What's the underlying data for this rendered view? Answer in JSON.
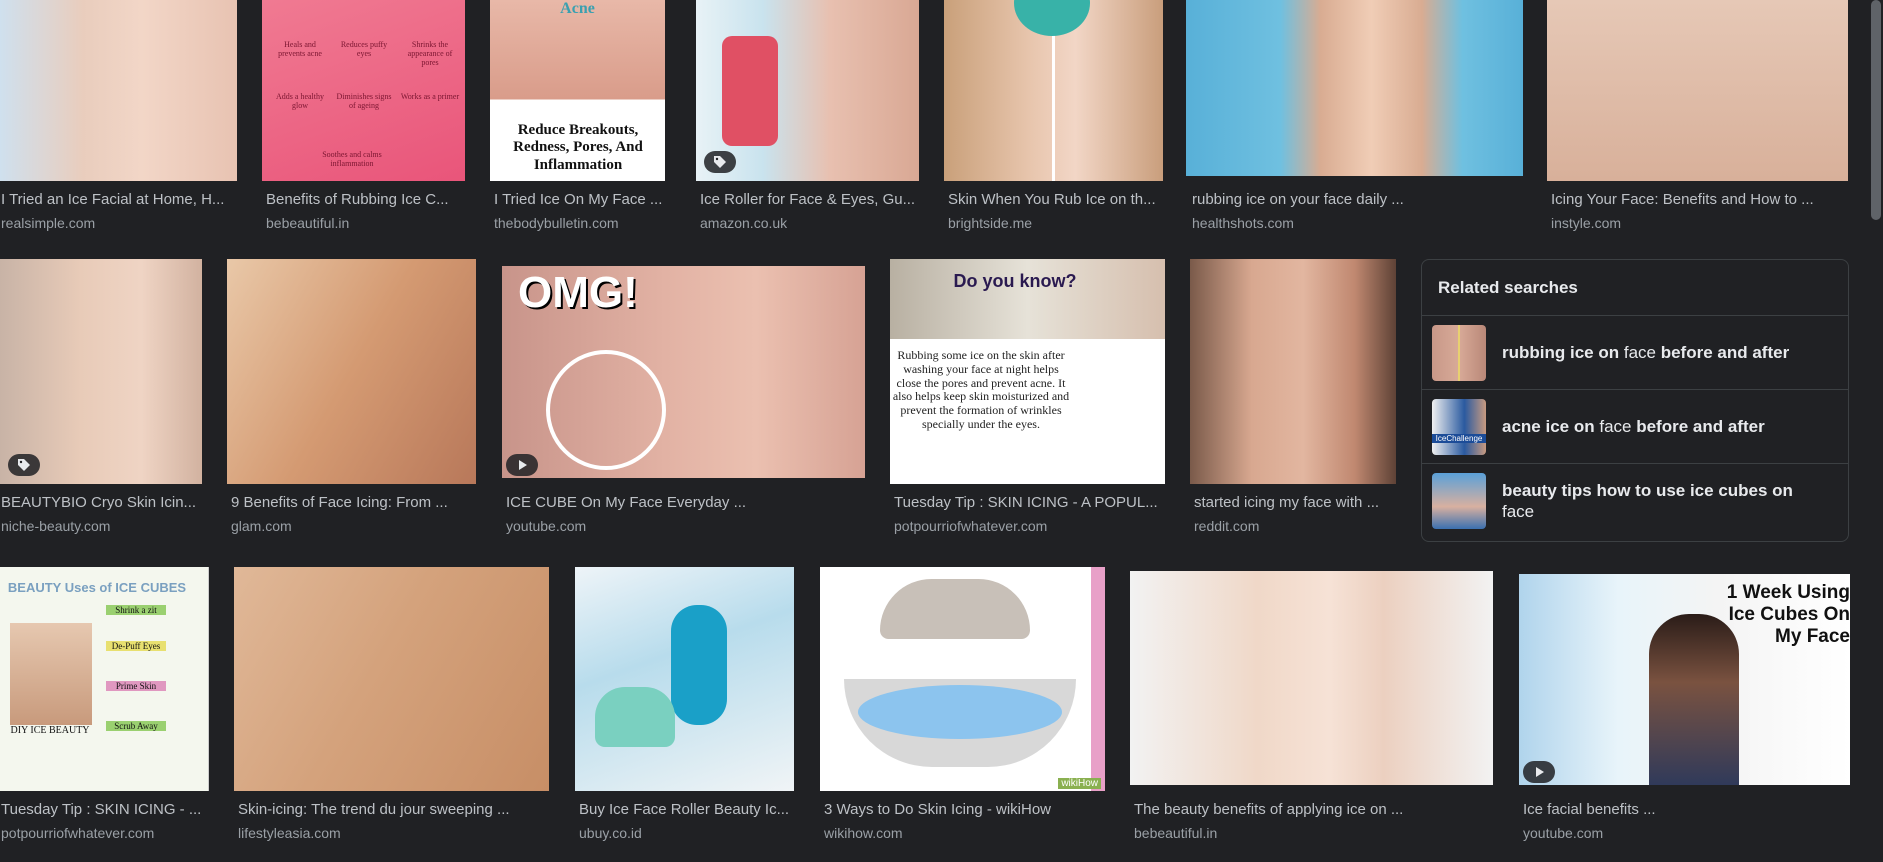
{
  "rows": [
    {
      "items": [
        {
          "title": "I Tried an Ice Facial at Home, H...",
          "source": "realsimple.com",
          "badge": ""
        },
        {
          "title": "Benefits of Rubbing Ice C...",
          "source": "bebeautiful.in",
          "badge": "",
          "overlay": [
            "Heals and prevents acne",
            "Reduces puffy eyes",
            "Shrinks the appearance of pores",
            "Adds a healthy glow",
            "Diminishes signs of ageing",
            "Works as a primer",
            "Soothes and calms inflammation"
          ]
        },
        {
          "title": "I Tried Ice On My Face ...",
          "source": "thebodybulletin.com",
          "badge": "",
          "overlay_top": "Acne",
          "overlay": "Reduce Breakouts, Redness, Pores, And Inflammation"
        },
        {
          "title": "Ice Roller for Face & Eyes, Gu...",
          "source": "amazon.co.uk",
          "badge": "tag"
        },
        {
          "title": "Skin When You Rub Ice on th...",
          "source": "brightside.me",
          "badge": ""
        },
        {
          "title": "rubbing ice on your face daily ...",
          "source": "healthshots.com",
          "badge": ""
        },
        {
          "title": "Icing Your Face: Benefits and How to ...",
          "source": "instyle.com",
          "badge": ""
        }
      ]
    },
    {
      "items": [
        {
          "title": "BEAUTYBIO Cryo Skin Icin...",
          "source": "niche-beauty.com",
          "badge": "tag"
        },
        {
          "title": "9 Benefits of Face Icing: From ...",
          "source": "glam.com",
          "badge": ""
        },
        {
          "title": "ICE CUBE On My Face Everyday ...",
          "source": "youtube.com",
          "badge": "play",
          "overlay": "OMG!"
        },
        {
          "title": "Tuesday Tip : SKIN ICING - A POPUL...",
          "source": "potpourriofwhatever.com",
          "badge": "",
          "overlay_top": "Do you know?",
          "overlay": "Rubbing some ice on the skin after washing your face at night helps close the pores and prevent acne. It also helps keep skin moisturized and prevent the formation of wrinkles specially under the eyes."
        },
        {
          "title": "started icing my face with ...",
          "source": "reddit.com",
          "badge": ""
        }
      ]
    },
    {
      "items": [
        {
          "title": "Tuesday Tip : SKIN ICING - ...",
          "source": "potpourriofwhatever.com",
          "badge": "",
          "overlay_top": "BEAUTY Uses of ICE CUBES",
          "overlay": [
            "Shrink a zit",
            "De-Puff Eyes",
            "Prime Skin",
            "Scrub Away",
            "DIY ICE BEAUTY"
          ]
        },
        {
          "title": "Skin-icing: The trend du jour sweeping ...",
          "source": "lifestyleasia.com",
          "badge": ""
        },
        {
          "title": "Buy Ice Face Roller Beauty Ic...",
          "source": "ubuy.co.id",
          "badge": ""
        },
        {
          "title": "3 Ways to Do Skin Icing - wikiHow",
          "source": "wikihow.com",
          "badge": "",
          "overlay": "wikiHow"
        },
        {
          "title": "The beauty benefits of applying ice on ...",
          "source": "bebeautiful.in",
          "badge": ""
        },
        {
          "title": "Ice facial benefits ...",
          "source": "youtube.com",
          "badge": "play",
          "overlay": "1 Week Using Ice Cubes On My Face"
        }
      ]
    }
  ],
  "related": {
    "heading": "Related searches",
    "items": [
      {
        "bold1": "rubbing ice on",
        "norm": "face",
        "bold2": "before and after"
      },
      {
        "bold1": "acne ice on",
        "norm": "face",
        "bold2": "before and after",
        "thumb_text": "IceChallenge"
      },
      {
        "bold1": "beauty tips how to use ice cubes on",
        "norm": "face",
        "bold2": ""
      }
    ]
  },
  "colors": {
    "background": "#202124",
    "title": "#bdc1c6",
    "source": "#9aa0a6"
  },
  "icons": {
    "tag": "tag-icon",
    "play": "play-icon"
  }
}
